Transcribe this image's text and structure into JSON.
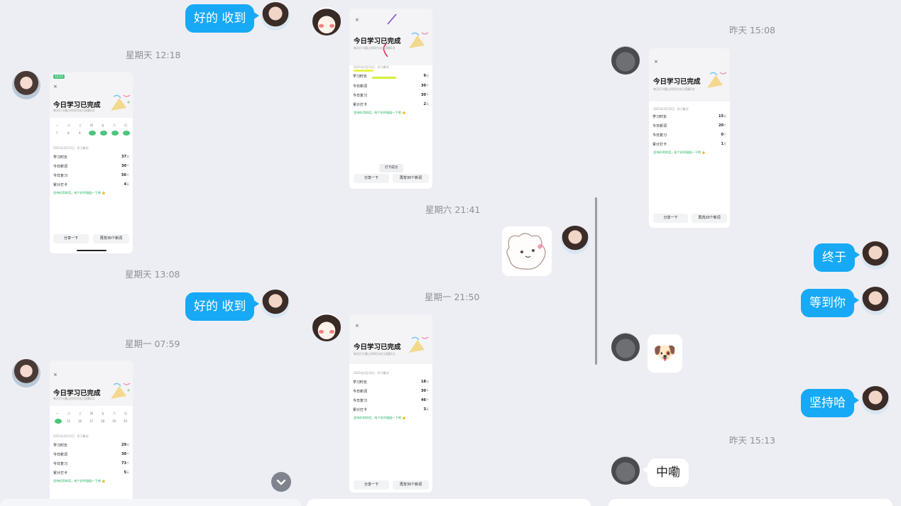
{
  "panel_left": {
    "bubble1": "好的 收到",
    "time1": "星期天 12:18",
    "shot1": {
      "status_time": "12:11",
      "close": "×",
      "title": "今日学习已完成",
      "subtitle": "每天打卡截止时间为次日凌晨2点",
      "weekdays": [
        "一",
        "二",
        "三",
        "四",
        "五",
        "六",
        "日"
      ],
      "dates": [
        "7",
        "8",
        "9",
        "",
        "",
        "",
        ""
      ],
      "section": "2021年3月12日 · 学习概况",
      "rows": [
        {
          "k": "学习时长",
          "v": "37",
          "u": "分"
        },
        {
          "k": "今日新词",
          "v": "30",
          "u": "个"
        },
        {
          "k": "今日复习",
          "v": "56",
          "u": "个"
        },
        {
          "k": "累计打卡",
          "v": "4",
          "u": "天"
        }
      ],
      "praise": "坚持好用的话，给个好评鼓励一下吧 👍",
      "btn_share": "分享一下",
      "btn_more": "再背30个新词"
    },
    "time2": "星期天 13:08",
    "bubble2": "好的 收到",
    "time3": "星期一 07:59",
    "shot2": {
      "status_time": "7:59",
      "close": "×",
      "title": "今日学习已完成",
      "subtitle": "每天打卡截止时间为次日凌晨2点",
      "weekdays": [
        "一",
        "二",
        "三",
        "四",
        "五",
        "六",
        "日"
      ],
      "dates": [
        "",
        "15",
        "16",
        "17",
        "18",
        "19",
        "20"
      ],
      "section": "2021年3月15日 · 学习概况",
      "rows": [
        {
          "k": "学习时长",
          "v": "29",
          "u": "分"
        },
        {
          "k": "今日新词",
          "v": "30",
          "u": "个"
        },
        {
          "k": "今日复习",
          "v": "73",
          "u": "个"
        },
        {
          "k": "累计打卡",
          "v": "5",
          "u": "天"
        }
      ],
      "praise": "坚持好用的话，给个好评鼓励一下吧 👍"
    }
  },
  "panel_middle": {
    "shot1": {
      "close": "×",
      "title": "今日学习已完成",
      "subtitle": "每天打卡截止时间为次日凌晨2点",
      "section": "2021年3月13日 · 学习概况",
      "rows": [
        {
          "k": "学习时长",
          "v": "9",
          "u": "分"
        },
        {
          "k": "今日新词",
          "v": "30",
          "u": "个"
        },
        {
          "k": "今日复习",
          "v": "30",
          "u": "个"
        },
        {
          "k": "累计打卡",
          "v": "2",
          "u": "天"
        }
      ],
      "praise": "坚持好用的话，给个好评鼓励一下吧 👍",
      "toast": "打卡成功",
      "btn_share": "分享一下",
      "btn_more": "再背30个新词"
    },
    "time1": "星期六 21:41",
    "time2": "星期一 21:50",
    "shot2": {
      "close": "×",
      "title": "今日学习已完成",
      "subtitle": "每天打卡截止时间为次日凌晨2点",
      "section": "2021年3月14日 · 学习概况",
      "rows": [
        {
          "k": "学习时长",
          "v": "18",
          "u": "分"
        },
        {
          "k": "今日新词",
          "v": "30",
          "u": "个"
        },
        {
          "k": "今日复习",
          "v": "46",
          "u": "个"
        },
        {
          "k": "累计打卡",
          "v": "3",
          "u": "天"
        }
      ],
      "praise": "坚持好用的话，给个好评鼓励一下吧 👍",
      "btn_share": "分享一下",
      "btn_more": "再背30个新词"
    }
  },
  "panel_right": {
    "time1": "昨天 15:08",
    "shot1": {
      "status_time": "12:07",
      "close": "×",
      "title": "今日学习已完成",
      "subtitle": "每天打卡截止时间为次日凌晨2点",
      "section": "2021年3月16日 · 学习概况",
      "rows": [
        {
          "k": "学习时长",
          "v": "15",
          "u": "分"
        },
        {
          "k": "今日新词",
          "v": "20",
          "u": "个"
        },
        {
          "k": "今日复习",
          "v": "0",
          "u": "个"
        },
        {
          "k": "累计打卡",
          "v": "1",
          "u": "天"
        }
      ],
      "praise": "坚持好用的话，给个好评鼓励一下吧 👍",
      "btn_share": "分享一下",
      "btn_more": "再背20个新词"
    },
    "bubble1": "终于",
    "bubble2": "等到你",
    "sticker_emoji": "🐶",
    "bubble3": "坚持哈",
    "time2": "昨天 15:13",
    "bubble4": "中嘞"
  },
  "icons": {
    "scroll_down": "chevron-down-icon"
  },
  "colors": {
    "bubble_blue": "#17a9f5",
    "praise_green": "#18b25a",
    "background": "#edeef4"
  }
}
